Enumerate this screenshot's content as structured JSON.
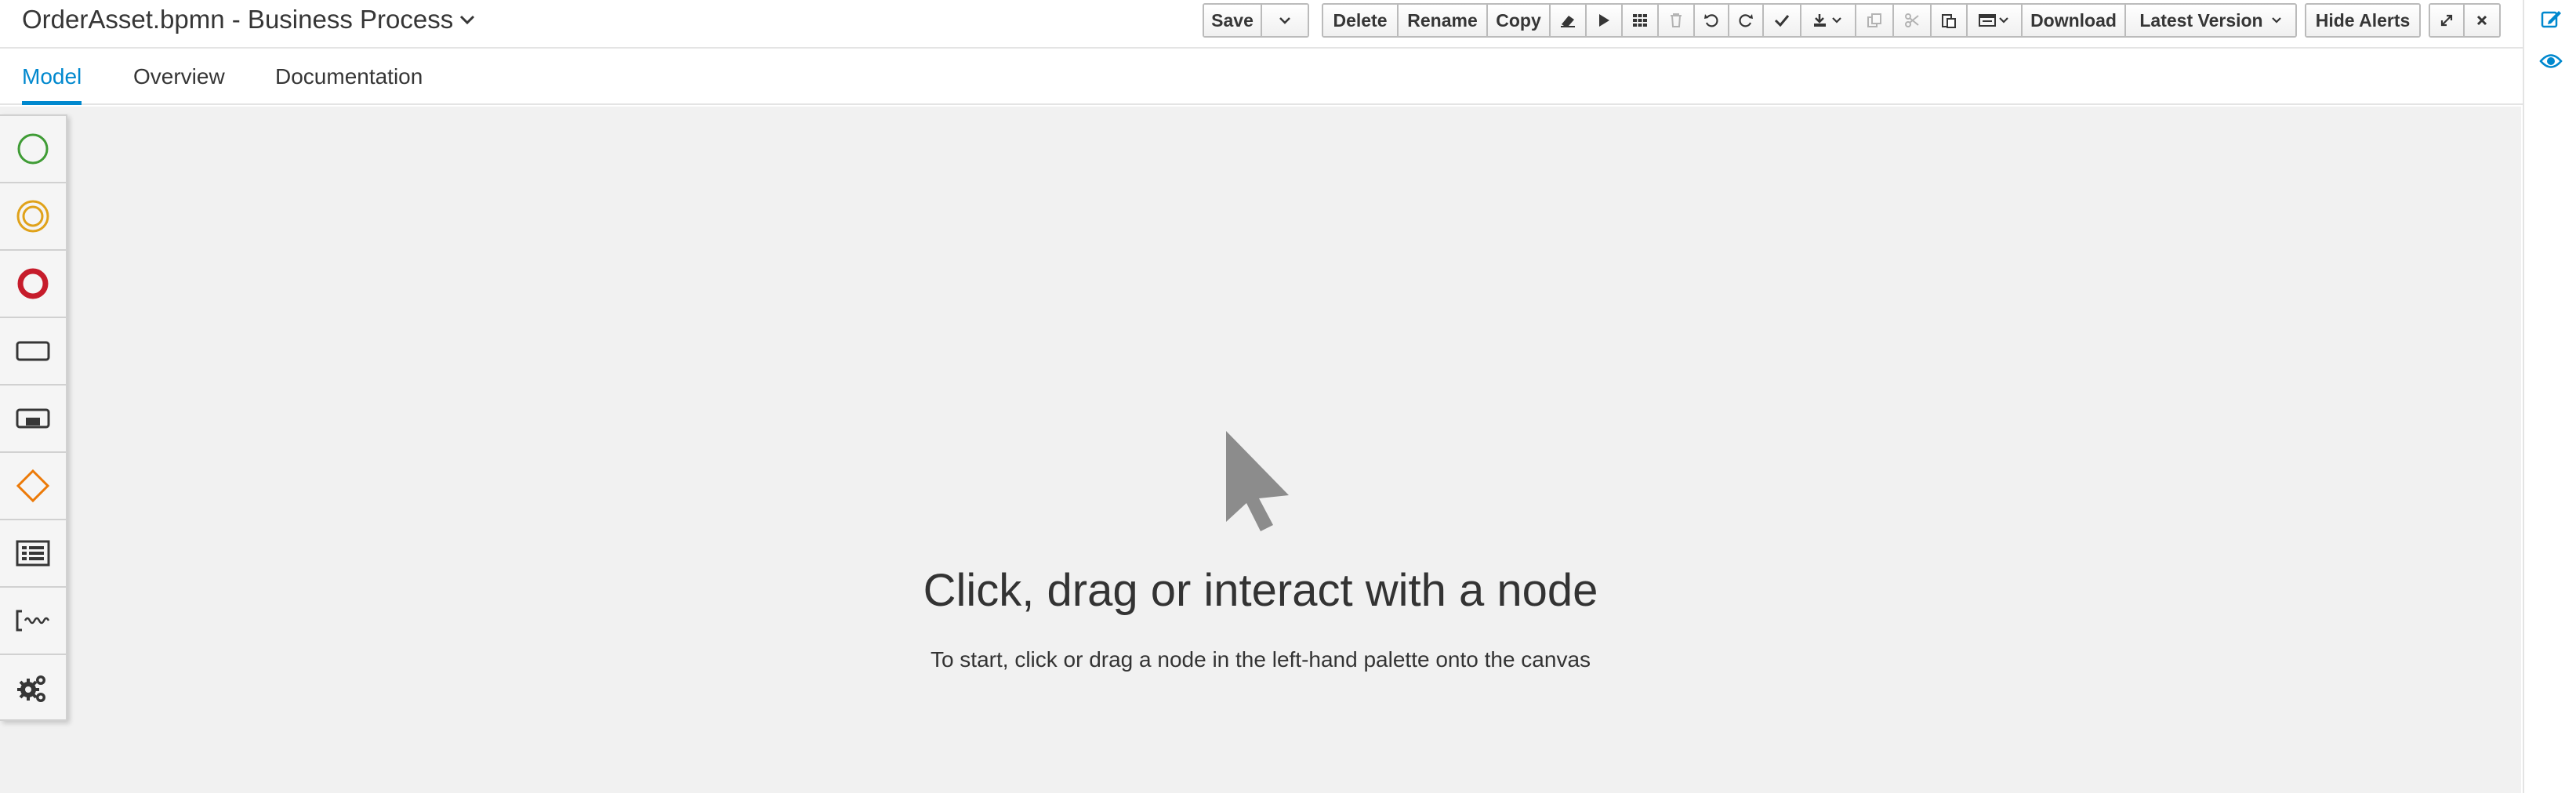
{
  "header": {
    "title": "OrderAsset.bpmn - Business Process",
    "title_menu_icon": "chevron-down-icon"
  },
  "toolbar": {
    "save": "Save",
    "delete": "Delete",
    "rename": "Rename",
    "copy": "Copy",
    "download": "Download",
    "latest_version": "Latest Version",
    "hide_alerts": "Hide Alerts",
    "icons": [
      "save-options-caret-icon",
      "eraser-icon",
      "play-icon",
      "grid-icon",
      "trash-icon",
      "undo-icon",
      "redo-icon",
      "check-icon",
      "import-export-icon",
      "duplicate-icon",
      "scissors-icon",
      "paste-icon",
      "form-icon",
      "expand-icon",
      "close-icon"
    ]
  },
  "tabs": [
    {
      "label": "Model",
      "active": true
    },
    {
      "label": "Overview",
      "active": false
    },
    {
      "label": "Documentation",
      "active": false
    }
  ],
  "palette": {
    "items": [
      {
        "name": "start-event-icon",
        "color": "#3f9c35"
      },
      {
        "name": "intermediate-event-icon",
        "color": "#e0a21a"
      },
      {
        "name": "end-event-icon",
        "color": "#c61c2b"
      },
      {
        "name": "task-icon",
        "color": "#363636"
      },
      {
        "name": "subprocess-icon",
        "color": "#363636"
      },
      {
        "name": "gateway-icon",
        "color": "#ec7a08"
      },
      {
        "name": "lane-icon",
        "color": "#363636"
      },
      {
        "name": "artifact-icon",
        "color": "#363636"
      },
      {
        "name": "custom-tasks-icon",
        "color": "#363636"
      }
    ]
  },
  "canvas": {
    "empty_title": "Click, drag or interact with a node",
    "empty_subtitle": "To start, click or drag a node in the left-hand palette onto the canvas",
    "empty_icon": "mouse-pointer-icon"
  },
  "right_rail": {
    "icons": [
      "edit-icon",
      "eye-icon"
    ],
    "accent": "#0088ce"
  }
}
